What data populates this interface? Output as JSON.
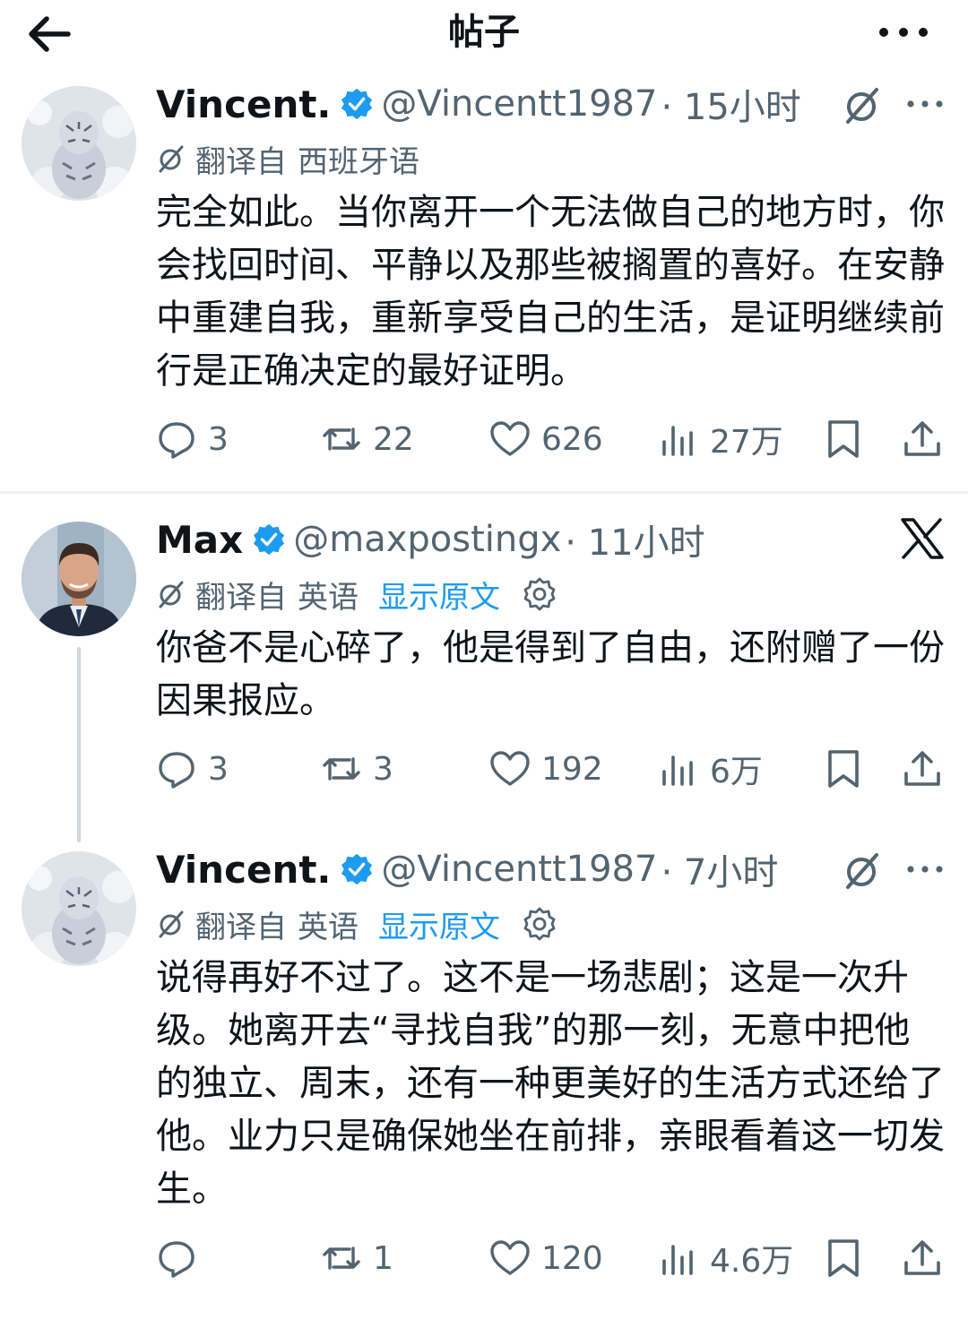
{
  "header": {
    "title": "帖子"
  },
  "posts": [
    {
      "name": "Vincent.",
      "handle": "@Vincentt1987",
      "time": "· 15小时",
      "translated_from": "翻译自",
      "language": "西班牙语",
      "show_original": "",
      "body": "完全如此。当你离开一个无法做自己的地方时，你会找回时间、平静以及那些被搁置的喜好。在安静中重建自我，重新享受自己的生活，是证明继续前行是正确决定的最好证明。",
      "stats": {
        "replies": "3",
        "reposts": "22",
        "likes": "626",
        "views": "27万"
      }
    },
    {
      "name": "Max",
      "handle": "@maxpostingx",
      "time": "· 11小时",
      "translated_from": "翻译自",
      "language": "英语",
      "show_original": "显示原文",
      "body": "你爸不是心碎了，他是得到了自由，还附赠了一份因果报应。",
      "stats": {
        "replies": "3",
        "reposts": "3",
        "likes": "192",
        "views": "6万"
      }
    },
    {
      "name": "Vincent.",
      "handle": "@Vincentt1987",
      "time": "· 7小时",
      "translated_from": "翻译自",
      "language": "英语",
      "show_original": "显示原文",
      "body": "说得再好不过了。这不是一场悲剧；这是一次升级。她离开去“寻找自我”的那一刻，无意中把他的独立、周末，还有一种更美好的生活方式还给了他。业力只是确保她坐在前排，亲眼看着这一切发生。",
      "stats": {
        "replies": "",
        "reposts": "1",
        "likes": "120",
        "views": "4.6万"
      }
    }
  ],
  "colors": {
    "text": "#0f1419",
    "secondary": "#536471",
    "accent": "#1d9bf0"
  }
}
